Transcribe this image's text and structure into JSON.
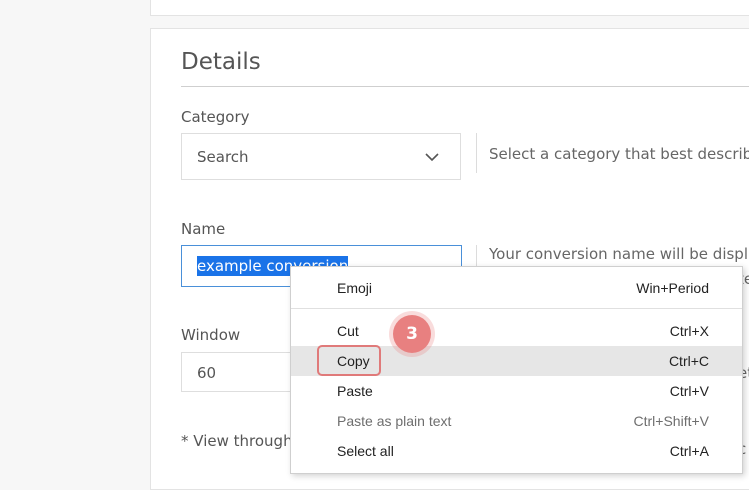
{
  "details": {
    "title": "Details",
    "category": {
      "label": "Category",
      "value": "Search",
      "help": "Select a category that best describe"
    },
    "name": {
      "label": "Name",
      "value": "example conversion",
      "help": "Your conversion name will be displ",
      "help_partial_line2": "te"
    },
    "window": {
      "label": "Window",
      "value": "60",
      "help_partial": "et"
    },
    "footnote": "* View through",
    "partial_right_chars": [
      "c"
    ]
  },
  "context_menu": {
    "items": [
      {
        "label": "Emoji",
        "shortcut": "Win+Period",
        "disabled": false
      },
      {
        "label": "Cut",
        "shortcut": "Ctrl+X",
        "disabled": false
      },
      {
        "label": "Copy",
        "shortcut": "Ctrl+C",
        "disabled": false,
        "hovered": true
      },
      {
        "label": "Paste",
        "shortcut": "Ctrl+V",
        "disabled": false
      },
      {
        "label": "Paste as plain text",
        "shortcut": "Ctrl+Shift+V",
        "disabled": true
      },
      {
        "label": "Select all",
        "shortcut": "Ctrl+A",
        "disabled": false
      }
    ]
  },
  "annotation": {
    "step_number": "3",
    "color": "#e88080"
  },
  "colors": {
    "selection": "#1a73e8",
    "focus_border": "#4a90d9",
    "page_bg": "#f7f7f7"
  }
}
